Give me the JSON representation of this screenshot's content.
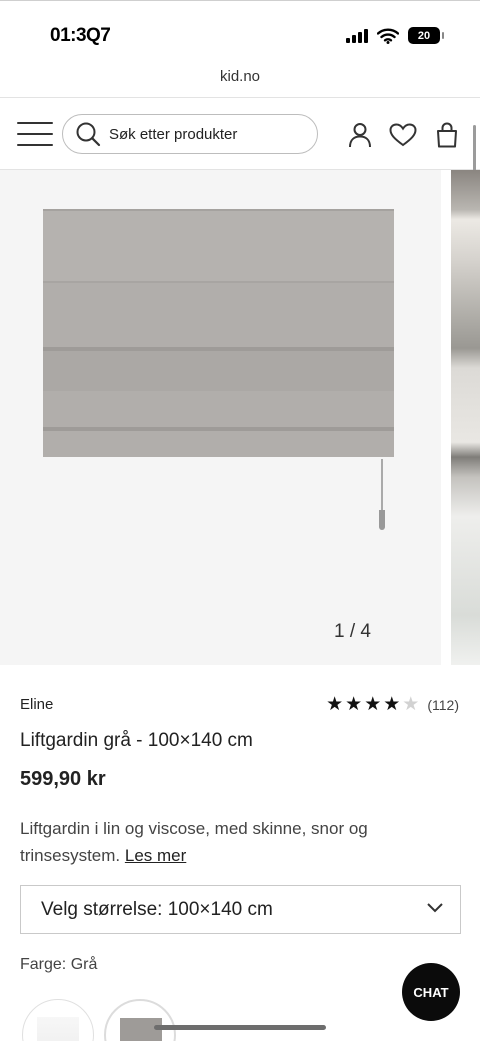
{
  "status_bar": {
    "time": "01:3Q7",
    "battery": "20"
  },
  "browser": {
    "url": "kid.no"
  },
  "header": {
    "search_placeholder": "Søk etter produkter"
  },
  "gallery": {
    "counter": "1 / 4",
    "current": 1,
    "total": 4
  },
  "product": {
    "brand": "Eline",
    "rating": 4,
    "rating_max": 5,
    "review_count": "(112)",
    "title": "Liftgardin grå - 100×140 cm",
    "price": "599,90 kr",
    "description": "Liftgardin i lin og viscose, med skinne, snor og trinsesystem.",
    "read_more": "Les mer"
  },
  "options": {
    "size_label": "Velg størrelse: 100×140 cm",
    "color_prefix": "Farge:",
    "color_value": "Grå"
  },
  "chat": {
    "label": "CHAT"
  },
  "colors": {
    "blind": "#b1aeab",
    "gallery_bg": "#f5f5f5",
    "chat_bg": "#0b0b0b"
  }
}
